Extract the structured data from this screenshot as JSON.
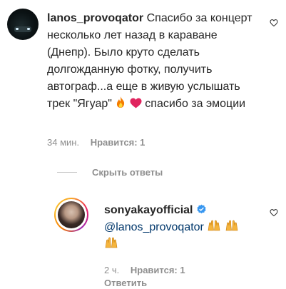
{
  "comment": {
    "username": "lanos_provoqator",
    "text_1": "Спасибо за концерт несколько лет назад в караване (Днепр). Было круто сделать долгожданную фотку, получить автограф...а еще в живую услышать трек \"Ягуар\"",
    "text_2": "спасибо за эмоции",
    "time": "34 мин.",
    "likes": "Нравится: 1"
  },
  "replies_toggle": "Скрыть ответы",
  "reply": {
    "username": "sonyakayofficial",
    "mention": "@lanos_provoqator",
    "time": "2 ч.",
    "likes": "Нравится: 1",
    "reply_label": "Ответить"
  },
  "colors": {
    "mention": "#00376b",
    "meta": "#8e8e8e",
    "verified": "#3897f0",
    "fire": "#f57c00",
    "red_heart": "#e0245e"
  },
  "icons": [
    "heart-outline-icon",
    "fire-emoji",
    "red-heart-emoji",
    "verified-badge-icon",
    "raising-hands-emoji"
  ]
}
